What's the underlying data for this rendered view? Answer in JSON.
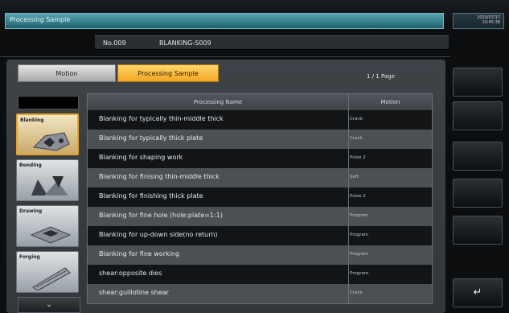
{
  "header": {
    "title": "Processing Sample",
    "date": "2020/07/17",
    "time": "10:45:38"
  },
  "program": {
    "number": "No.009",
    "name": "BLANKING-S009"
  },
  "tabs": {
    "motion": "Motion",
    "processing_sample": "Processing Sample"
  },
  "page_indicator": "1 / 1 Page",
  "categories": [
    {
      "label": "Blanking",
      "selected": true
    },
    {
      "label": "Bending",
      "selected": false
    },
    {
      "label": "Drawing",
      "selected": false
    },
    {
      "label": "Forging",
      "selected": false
    }
  ],
  "table": {
    "headers": {
      "name": "Processing Name",
      "motion": "Motion"
    },
    "rows": [
      {
        "name": "Blanking for typically thin-middle thick",
        "motion": "Crank"
      },
      {
        "name": "Blanking for typically thick plate",
        "motion": "Crank"
      },
      {
        "name": "Blanking for shaping work",
        "motion": "Pulse 2"
      },
      {
        "name": "Blanking for finising thin-middle thick",
        "motion": "Soft"
      },
      {
        "name": "Blanking for finishing thick plate",
        "motion": "Pulse 2"
      },
      {
        "name": "Blanking for fine hole (hole:plate=1:1)",
        "motion": "Program"
      },
      {
        "name": "Blanking for up-down side(no return)",
        "motion": "Program"
      },
      {
        "name": "Blanking for fine working",
        "motion": "Program"
      },
      {
        "name": "shear:opposite dies",
        "motion": "Program"
      },
      {
        "name": "shear:guillotine shear",
        "motion": "Crank"
      }
    ]
  },
  "icons": {
    "scroll_down": "chevron-down-icon",
    "return": "return-arrow-icon"
  },
  "colors": {
    "title_bar": "#2f7784",
    "selected_tab": "#f5a623",
    "selected_category_border": "#e6a32a"
  }
}
